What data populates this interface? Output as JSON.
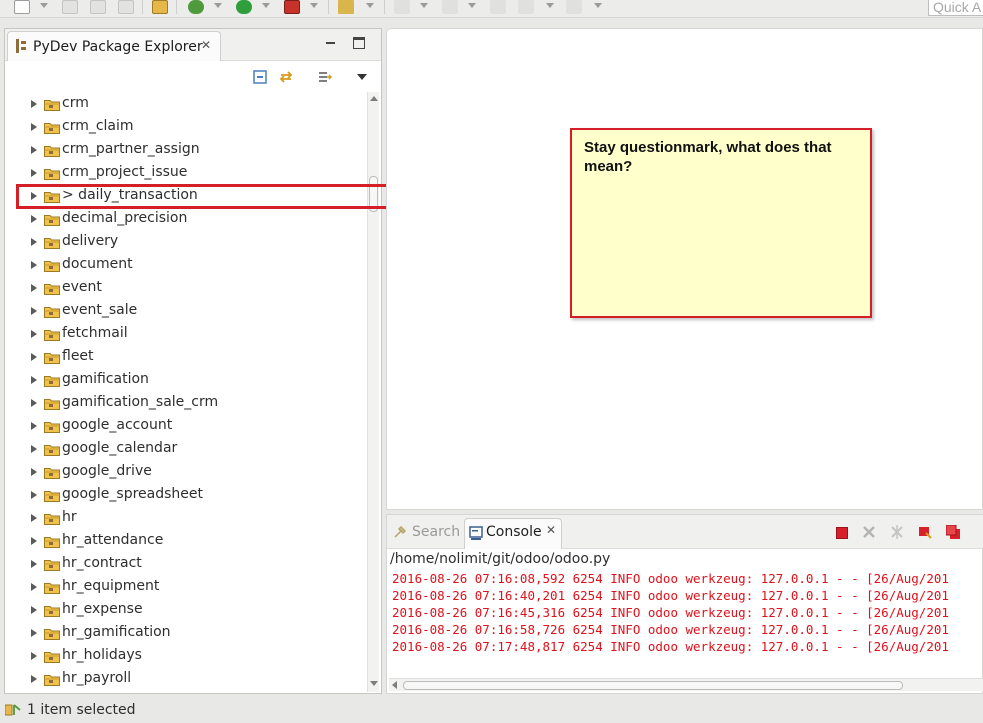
{
  "toolbar": {
    "quick_access_placeholder": "Quick A"
  },
  "explorer": {
    "title": "PyDev Package Explorer",
    "close_glyph": "✕",
    "items": [
      {
        "label": "crm"
      },
      {
        "label": "crm_claim"
      },
      {
        "label": "crm_partner_assign"
      },
      {
        "label": "crm_project_issue"
      },
      {
        "label": "> daily_transaction"
      },
      {
        "label": "decimal_precision"
      },
      {
        "label": "delivery"
      },
      {
        "label": "document"
      },
      {
        "label": "event"
      },
      {
        "label": "event_sale"
      },
      {
        "label": "fetchmail"
      },
      {
        "label": "fleet"
      },
      {
        "label": "gamification"
      },
      {
        "label": "gamification_sale_crm"
      },
      {
        "label": "google_account"
      },
      {
        "label": "google_calendar"
      },
      {
        "label": "google_drive"
      },
      {
        "label": "google_spreadsheet"
      },
      {
        "label": "hr"
      },
      {
        "label": "hr_attendance"
      },
      {
        "label": "hr_contract"
      },
      {
        "label": "hr_equipment"
      },
      {
        "label": "hr_expense"
      },
      {
        "label": "hr_gamification"
      },
      {
        "label": "hr_holidays"
      },
      {
        "label": "hr_payroll"
      }
    ]
  },
  "annotation": {
    "note_text": "Stay questionmark, what does that mean?",
    "accent_color": "#d51f26",
    "note_color": "#ffffcc"
  },
  "console": {
    "search_tab": "Search",
    "console_tab": "Console",
    "close_glyph": "✕",
    "path": "/home/nolimit/git/odoo/odoo.py",
    "log_color": "#e0111b",
    "lines": [
      "2016-08-26 07:16:08,592 6254 INFO odoo werkzeug: 127.0.0.1 - - [26/Aug/201",
      "2016-08-26 07:16:40,201 6254 INFO odoo werkzeug: 127.0.0.1 - - [26/Aug/201",
      "2016-08-26 07:16:45,316 6254 INFO odoo werkzeug: 127.0.0.1 - - [26/Aug/201",
      "2016-08-26 07:16:58,726 6254 INFO odoo werkzeug: 127.0.0.1 - - [26/Aug/201",
      "2016-08-26 07:17:48,817 6254 INFO odoo werkzeug: 127.0.0.1 - - [26/Aug/201"
    ]
  },
  "status": {
    "text": "1 item selected"
  }
}
